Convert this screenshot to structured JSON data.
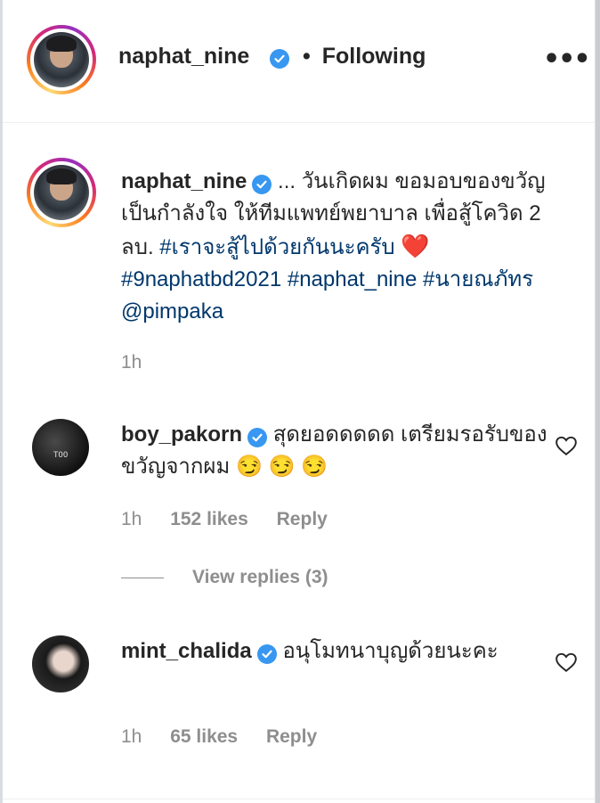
{
  "header": {
    "username": "naphat_nine",
    "separator": "•",
    "follow_status": "Following",
    "more_icon": "more-horizontal-icon"
  },
  "caption": {
    "username": "naphat_nine",
    "text_part1": " ... วันเกิดผม ขอมอบของขวัญ เป็นกำลังใจ ให้ทีมแพทย์พยาบาล เพื่อสู้โควิด 2 ลบ. ",
    "hashtag1": "#เราจะสู้ไปด้วยกันนะครับ",
    "heart": "❤️",
    "hashtag2": "#9naphatbd2021",
    "hashtag3": "#naphat_nine",
    "hashtag4": "#นายณภัทร",
    "mention": "@pimpaka",
    "time": "1h"
  },
  "comments": [
    {
      "username": "boy_pakorn",
      "text": " สุดยอดดดดด เตรียมรอรับของขวัญจากผม ",
      "emojis": "😏 😏 😏",
      "time": "1h",
      "likes": "152 likes",
      "reply": "Reply",
      "view_replies": "View replies (3)"
    },
    {
      "username": "mint_chalida",
      "text": " อนุโมทนาบุญด้วยนะคะ",
      "time": "1h",
      "likes": "65 likes",
      "reply": "Reply"
    }
  ],
  "colors": {
    "verified": "#3897f0",
    "hashtag": "#00376b",
    "meta": "#8e8e8e",
    "text": "#262626"
  }
}
